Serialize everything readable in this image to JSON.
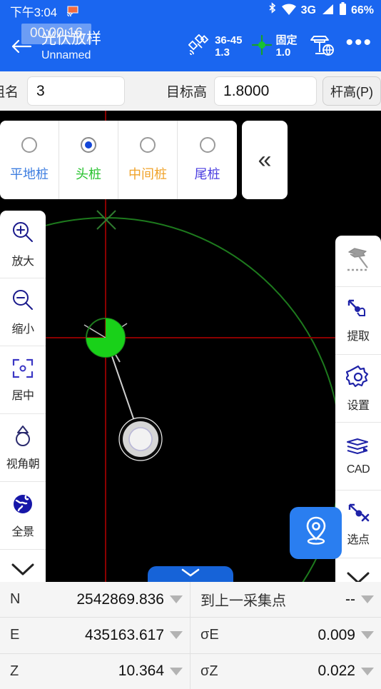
{
  "statusbar": {
    "clock": "下午3:04",
    "cast_icon": "screen-cast-icon",
    "bluetooth_icon": "bluetooth-icon",
    "wifi_icon": "wifi-icon",
    "network": "3G",
    "signal_icon": "cellular-signal-icon",
    "battery": "66%"
  },
  "titlebar": {
    "back_icon": "back-arrow-icon",
    "title": "光伏放样",
    "subtitle": "Unnamed",
    "toast": "00:00:16",
    "satellite": {
      "icon": "satellite-icon",
      "line1": "36-45",
      "line2": "1.3"
    },
    "fix": {
      "icon": "crosshair-icon",
      "line1": "固定",
      "line2": "1.0"
    },
    "device_icon": "gnss-receiver-icon",
    "more": "•••"
  },
  "params": {
    "group_label": "组名",
    "group_value": "3",
    "target_height_label": "目标高",
    "target_height_value": "1.8000",
    "pole_button": "杆高(P)"
  },
  "stake_types": {
    "options": [
      {
        "label": "平地桩",
        "color": "#3d7de0",
        "selected": false
      },
      {
        "label": "头桩",
        "color": "#27c22e",
        "selected": true
      },
      {
        "label": "中间桩",
        "color": "#f0a32a",
        "selected": false
      },
      {
        "label": "尾桩",
        "color": "#4a3de0",
        "selected": false
      }
    ],
    "collapse_label": "«"
  },
  "left_toolbar": [
    {
      "label": "放大",
      "icon": "zoom-in-icon"
    },
    {
      "label": "缩小",
      "icon": "zoom-out-icon"
    },
    {
      "label": "居中",
      "icon": "center-target-icon"
    },
    {
      "label": "视角朝",
      "icon": "view-orientation-icon"
    },
    {
      "label": "全景",
      "icon": "globe-icon"
    },
    {
      "label": "",
      "icon": "chevron-down-icon"
    }
  ],
  "right_toolbar": [
    {
      "label": "",
      "icon": "base-station-icon"
    },
    {
      "label": "提取",
      "icon": "extract-point-icon"
    },
    {
      "label": "设置",
      "icon": "gear-icon"
    },
    {
      "label": "CAD",
      "icon": "cad-layers-icon"
    },
    {
      "label": "选点",
      "icon": "select-point-icon"
    },
    {
      "label": "",
      "icon": "chevron-down-icon"
    }
  ],
  "map": {
    "collect_button_icon": "location-pin-icon",
    "bottom_handle_icon": "chevron-down-icon",
    "crosshair_color": "#8b0000",
    "circle_color": "#1d7a1d",
    "target_color": "#19d119",
    "marker_color": "#d8d8d8"
  },
  "data_grid": {
    "rows": [
      {
        "left_key": "N",
        "left_value": "2542869.836",
        "right_key": "到上一采集点",
        "right_value": "--"
      },
      {
        "left_key": "E",
        "left_value": "435163.617",
        "right_key": "σE",
        "right_value": "0.009"
      },
      {
        "left_key": "Z",
        "left_value": "10.364",
        "right_key": "σZ",
        "right_value": "0.022"
      }
    ]
  }
}
